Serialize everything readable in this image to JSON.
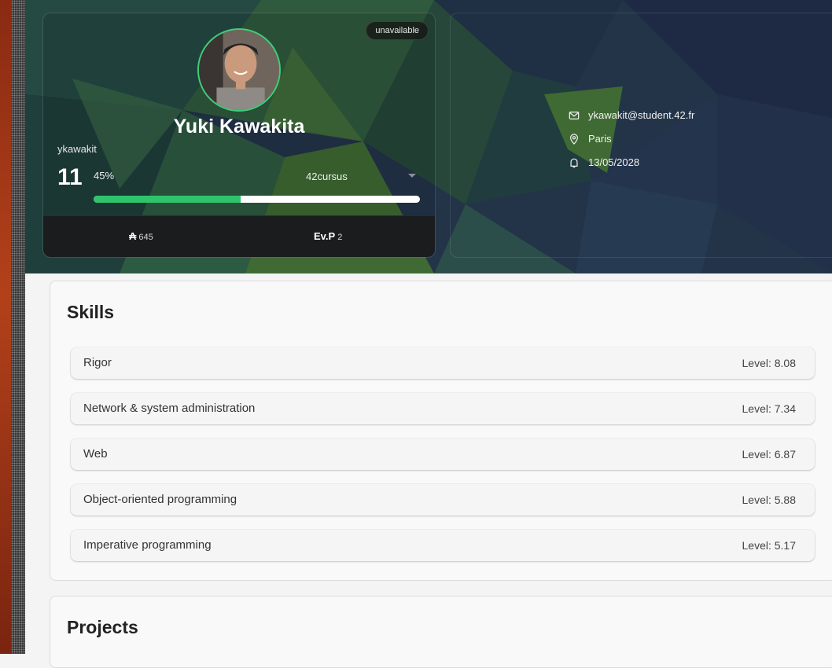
{
  "profile": {
    "status": "unavailable",
    "full_name": "Yuki Kawakita",
    "login": "ykawakit",
    "level_int": "11",
    "level_pct": "45%",
    "level_progress": 0.45,
    "cursus": "42cursus",
    "wallet_value": "645",
    "evp_label": "Ev.P",
    "evp_value": "2"
  },
  "info": {
    "email": "ykawakit@student.42.fr",
    "location": "Paris",
    "date": "13/05/2028"
  },
  "skills": {
    "title": "Skills",
    "items": [
      {
        "name": "Rigor",
        "level": "Level: 8.08"
      },
      {
        "name": "Network & system administration",
        "level": "Level: 7.34"
      },
      {
        "name": "Web",
        "level": "Level: 6.87"
      },
      {
        "name": "Object-oriented programming",
        "level": "Level: 5.88"
      },
      {
        "name": "Imperative programming",
        "level": "Level: 5.17"
      }
    ]
  },
  "projects": {
    "title": "Projects"
  },
  "colors": {
    "accent": "#2fc46c",
    "card_dark": "#1b1c1e"
  },
  "icons": [
    "wallet-icon",
    "mail-icon",
    "location-pin-icon",
    "bell-icon",
    "chevron-down-icon"
  ]
}
